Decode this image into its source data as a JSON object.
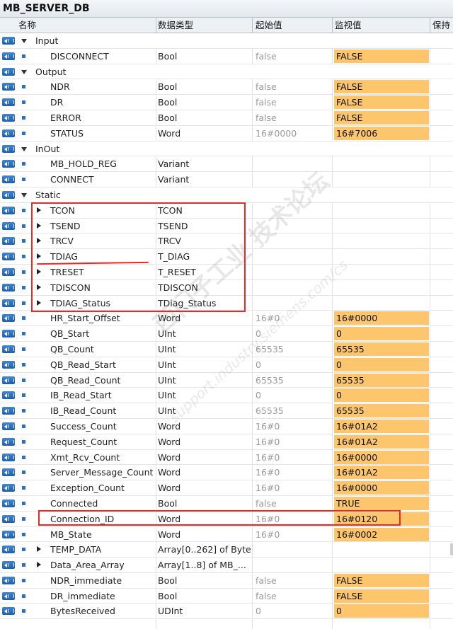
{
  "window": {
    "title": "MB_SERVER_DB"
  },
  "columns": {
    "name": "名称",
    "type": "数据类型",
    "start": "起始值",
    "monitor": "监视值",
    "retain": "保持"
  },
  "rows": [
    {
      "kind": "section",
      "name": "Input",
      "type": "",
      "start": "",
      "monitor": ""
    },
    {
      "kind": "item",
      "name": "DISCONNECT",
      "type": "Bool",
      "start": "false",
      "monitor": "FALSE"
    },
    {
      "kind": "section",
      "name": "Output",
      "type": "",
      "start": "",
      "monitor": ""
    },
    {
      "kind": "item",
      "name": "NDR",
      "type": "Bool",
      "start": "false",
      "monitor": "FALSE"
    },
    {
      "kind": "item",
      "name": "DR",
      "type": "Bool",
      "start": "false",
      "monitor": "FALSE"
    },
    {
      "kind": "item",
      "name": "ERROR",
      "type": "Bool",
      "start": "false",
      "monitor": "FALSE"
    },
    {
      "kind": "item",
      "name": "STATUS",
      "type": "Word",
      "start": "16#0000",
      "monitor": "16#7006"
    },
    {
      "kind": "section",
      "name": "InOut",
      "type": "",
      "start": "",
      "monitor": ""
    },
    {
      "kind": "item",
      "name": "MB_HOLD_REG",
      "type": "Variant",
      "start": "",
      "monitor": ""
    },
    {
      "kind": "item",
      "name": "CONNECT",
      "type": "Variant",
      "start": "",
      "monitor": ""
    },
    {
      "kind": "section",
      "name": "Static",
      "type": "",
      "start": "",
      "monitor": ""
    },
    {
      "kind": "struct",
      "name": "TCON",
      "type": "TCON",
      "start": "",
      "monitor": ""
    },
    {
      "kind": "struct",
      "name": "TSEND",
      "type": "TSEND",
      "start": "",
      "monitor": ""
    },
    {
      "kind": "struct",
      "name": "TRCV",
      "type": "TRCV",
      "start": "",
      "monitor": ""
    },
    {
      "kind": "struct",
      "name": "TDIAG",
      "type": "T_DIAG",
      "start": "",
      "monitor": ""
    },
    {
      "kind": "struct",
      "name": "TRESET",
      "type": "T_RESET",
      "start": "",
      "monitor": ""
    },
    {
      "kind": "struct",
      "name": "TDISCON",
      "type": "TDISCON",
      "start": "",
      "monitor": ""
    },
    {
      "kind": "struct",
      "name": "TDIAG_Status",
      "type": "TDiag_Status",
      "start": "",
      "monitor": ""
    },
    {
      "kind": "item",
      "name": "HR_Start_Offset",
      "type": "Word",
      "start": "16#0",
      "monitor": "16#0000"
    },
    {
      "kind": "item",
      "name": "QB_Start",
      "type": "UInt",
      "start": "0",
      "monitor": "0"
    },
    {
      "kind": "item",
      "name": "QB_Count",
      "type": "UInt",
      "start": "65535",
      "monitor": "65535"
    },
    {
      "kind": "item",
      "name": "QB_Read_Start",
      "type": "UInt",
      "start": "0",
      "monitor": "0"
    },
    {
      "kind": "item",
      "name": "QB_Read_Count",
      "type": "UInt",
      "start": "65535",
      "monitor": "65535"
    },
    {
      "kind": "item",
      "name": "IB_Read_Start",
      "type": "UInt",
      "start": "0",
      "monitor": "0"
    },
    {
      "kind": "item",
      "name": "IB_Read_Count",
      "type": "UInt",
      "start": "65535",
      "monitor": "65535"
    },
    {
      "kind": "item",
      "name": "Success_Count",
      "type": "Word",
      "start": "16#0",
      "monitor": "16#01A2"
    },
    {
      "kind": "item",
      "name": "Request_Count",
      "type": "Word",
      "start": "16#0",
      "monitor": "16#01A2"
    },
    {
      "kind": "item",
      "name": "Xmt_Rcv_Count",
      "type": "Word",
      "start": "16#0",
      "monitor": "16#0000"
    },
    {
      "kind": "item",
      "name": "Server_Message_Count",
      "type": "Word",
      "start": "16#0",
      "monitor": "16#01A2"
    },
    {
      "kind": "item",
      "name": "Exception_Count",
      "type": "Word",
      "start": "16#0",
      "monitor": "16#0000"
    },
    {
      "kind": "item",
      "name": "Connected",
      "type": "Bool",
      "start": "false",
      "monitor": "TRUE"
    },
    {
      "kind": "item",
      "name": "Connection_ID",
      "type": "Word",
      "start": "16#0",
      "monitor": "16#0120"
    },
    {
      "kind": "item",
      "name": "MB_State",
      "type": "Word",
      "start": "16#0",
      "monitor": "16#0002"
    },
    {
      "kind": "struct",
      "name": "TEMP_DATA",
      "type": "Array[0..262] of Byte",
      "start": "",
      "monitor": ""
    },
    {
      "kind": "struct",
      "name": "Data_Area_Array",
      "type": "Array[1..8] of MB_...",
      "start": "",
      "monitor": ""
    },
    {
      "kind": "item",
      "name": "NDR_immediate",
      "type": "Bool",
      "start": "false",
      "monitor": "FALSE"
    },
    {
      "kind": "item",
      "name": "DR_immediate",
      "type": "Bool",
      "start": "false",
      "monitor": "FALSE"
    },
    {
      "kind": "item",
      "name": "BytesReceived",
      "type": "UDInt",
      "start": "0",
      "monitor": "0"
    }
  ],
  "watermark": {
    "text1": "西门子工业 技术论坛",
    "text2": "support.industry.siemens.com/cs"
  },
  "colors": {
    "monitor_bg": "#fdc66d",
    "highlight": "#e52a2a",
    "icon_blue": "#2e6dc0"
  }
}
